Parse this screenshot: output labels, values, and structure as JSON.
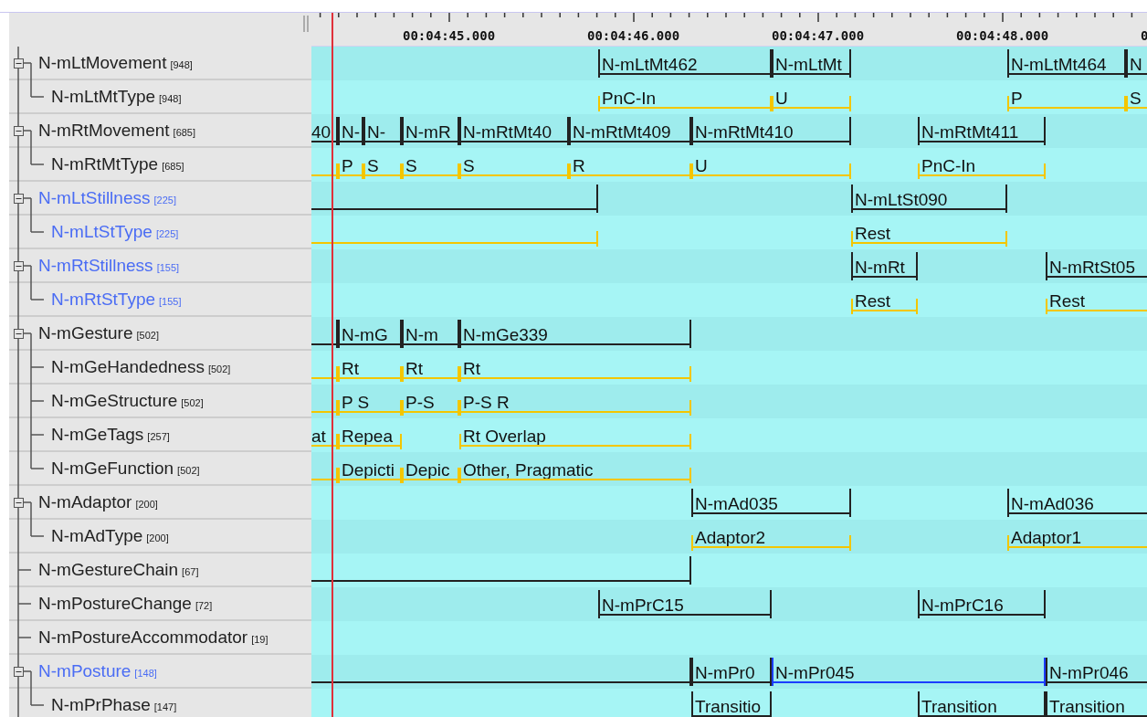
{
  "ruler": {
    "labels": [
      "00:04:45.000",
      "00:04:46.000",
      "00:04:47.000",
      "00:04:48.000",
      "0"
    ]
  },
  "tiers": [
    {
      "name": "N-mLtMovement",
      "count": "[948]",
      "color": "#222222",
      "kind": "time",
      "expanded": true,
      "annotations": [
        {
          "value": "N-mLtMt462",
          "selected": false
        },
        {
          "value": "N-mLtMt",
          "selected": false
        },
        {
          "value": "N-mLtMt464",
          "selected": false
        },
        {
          "value": "N",
          "selected": false
        }
      ],
      "children": [
        {
          "name": "N-mLtMtType",
          "count": "[948]",
          "color": "#222222",
          "kind": "symbolic",
          "annotations": [
            {
              "value": "PnC-In",
              "selected": false
            },
            {
              "value": "U",
              "selected": false
            },
            {
              "value": "P",
              "selected": false
            },
            {
              "value": "S",
              "selected": false
            }
          ]
        }
      ]
    },
    {
      "name": "N-mRtMovement",
      "count": "[685]",
      "color": "#222222",
      "kind": "time",
      "expanded": true,
      "annotations": [
        {
          "value": "40",
          "selected": false
        },
        {
          "value": "N-",
          "selected": false
        },
        {
          "value": "N-",
          "selected": false
        },
        {
          "value": "N-mR",
          "selected": false
        },
        {
          "value": "N-mRtMt40",
          "selected": false
        },
        {
          "value": "N-mRtMt409",
          "selected": false
        },
        {
          "value": "N-mRtMt410",
          "selected": false
        },
        {
          "value": "N-mRtMt411",
          "selected": false
        }
      ],
      "children": [
        {
          "name": "N-mRtMtType",
          "count": "[685]",
          "color": "#222222",
          "kind": "symbolic",
          "annotations": [
            {
              "selected": false
            },
            {
              "value": "P",
              "selected": false
            },
            {
              "value": "S",
              "selected": false
            },
            {
              "value": "S",
              "selected": false
            },
            {
              "value": "S",
              "selected": false
            },
            {
              "value": "R",
              "selected": false
            },
            {
              "value": "U",
              "selected": false
            },
            {
              "value": "PnC-In",
              "selected": false
            }
          ]
        }
      ]
    },
    {
      "name": "N-mLtStillness",
      "count": "[225]",
      "color": "#4a6cf4",
      "kind": "time",
      "expanded": true,
      "annotations": [
        {
          "selected": false
        },
        {
          "value": "N-mLtSt090",
          "selected": false
        }
      ],
      "children": [
        {
          "name": "N-mLtStType",
          "count": "[225]",
          "color": "#4a6cf4",
          "kind": "symbolic",
          "annotations": [
            {
              "selected": false
            },
            {
              "value": "Rest",
              "selected": false
            }
          ]
        }
      ]
    },
    {
      "name": "N-mRtStillness",
      "count": "[155]",
      "color": "#4a6cf4",
      "kind": "time",
      "expanded": true,
      "annotations": [
        {
          "value": "N-mRt",
          "selected": false
        },
        {
          "value": "N-mRtSt05",
          "selected": false
        }
      ],
      "children": [
        {
          "name": "N-mRtStType",
          "count": "[155]",
          "color": "#4a6cf4",
          "kind": "symbolic",
          "annotations": [
            {
              "value": "Rest",
              "selected": false
            },
            {
              "value": "Rest",
              "selected": false
            }
          ]
        }
      ]
    },
    {
      "name": "N-mGesture",
      "count": "[502]",
      "color": "#222222",
      "kind": "time",
      "expanded": true,
      "annotations": [
        {
          "selected": false
        },
        {
          "value": "N-mG",
          "selected": false
        },
        {
          "value": "N-m",
          "selected": false
        },
        {
          "value": "N-mGe339",
          "selected": false
        }
      ],
      "children": [
        {
          "name": "N-mGeHandedness",
          "count": "[502]",
          "color": "#222222",
          "kind": "symbolic",
          "annotations": [
            {
              "selected": false
            },
            {
              "value": "Rt",
              "selected": false
            },
            {
              "value": "Rt",
              "selected": false
            },
            {
              "value": "Rt",
              "selected": false
            }
          ]
        },
        {
          "name": "N-mGeStructure",
          "count": "[502]",
          "color": "#222222",
          "kind": "symbolic",
          "annotations": [
            {
              "selected": false
            },
            {
              "value": "P S",
              "selected": false
            },
            {
              "value": "P-S",
              "selected": false
            },
            {
              "value": "P-S R",
              "selected": false
            }
          ]
        },
        {
          "name": "N-mGeTags",
          "count": "[257]",
          "color": "#222222",
          "kind": "symbolic",
          "annotations": [
            {
              "value": "at",
              "selected": false
            },
            {
              "value": "Repea",
              "selected": false
            },
            {
              "value": "Rt Overlap",
              "selected": false
            }
          ]
        },
        {
          "name": "N-mGeFunction",
          "count": "[502]",
          "color": "#222222",
          "kind": "symbolic",
          "annotations": [
            {
              "selected": false
            },
            {
              "value": "Depicti",
              "selected": false
            },
            {
              "value": "Depic",
              "selected": false
            },
            {
              "value": "Other, Pragmatic",
              "selected": false
            }
          ]
        }
      ]
    },
    {
      "name": "N-mAdaptor",
      "count": "[200]",
      "color": "#222222",
      "kind": "time",
      "expanded": true,
      "annotations": [
        {
          "value": "N-mAd035",
          "selected": false
        },
        {
          "value": "N-mAd036",
          "selected": false
        }
      ],
      "children": [
        {
          "name": "N-mAdType",
          "count": "[200]",
          "color": "#222222",
          "kind": "symbolic",
          "annotations": [
            {
              "value": "Adaptor2",
              "selected": false
            },
            {
              "value": "Adaptor1",
              "selected": false
            }
          ]
        }
      ]
    },
    {
      "name": "N-mGestureChain",
      "count": "[67]",
      "color": "#222222",
      "kind": "time",
      "annotations": [
        {
          "selected": false
        }
      ]
    },
    {
      "name": "N-mPostureChange",
      "count": "[72]",
      "color": "#222222",
      "kind": "time",
      "annotations": [
        {
          "value": "N-mPrC15",
          "selected": false
        },
        {
          "value": "N-mPrC16",
          "selected": false
        }
      ]
    },
    {
      "name": "N-mPostureAccommodator",
      "count": "[19]",
      "color": "#222222"
    },
    {
      "name": "N-mPosture",
      "count": "[148]",
      "color": "#4a6cf4",
      "kind": "time",
      "expanded": true,
      "annotations": [
        {
          "selected": false
        },
        {
          "value": "N-mPr0",
          "selected": false
        },
        {
          "value": "N-mPr045",
          "selected": true
        },
        {
          "value": "N-mPr046",
          "selected": false
        }
      ],
      "children": [
        {
          "name": "N-mPrPhase",
          "count": "[147]",
          "color": "#222222",
          "kind": "time",
          "annotations": [
            {
              "value": "Transitio",
              "selected": false
            },
            {
              "value": "Transition",
              "selected": false
            },
            {
              "value": "Transition",
              "selected": false
            }
          ]
        }
      ]
    }
  ]
}
